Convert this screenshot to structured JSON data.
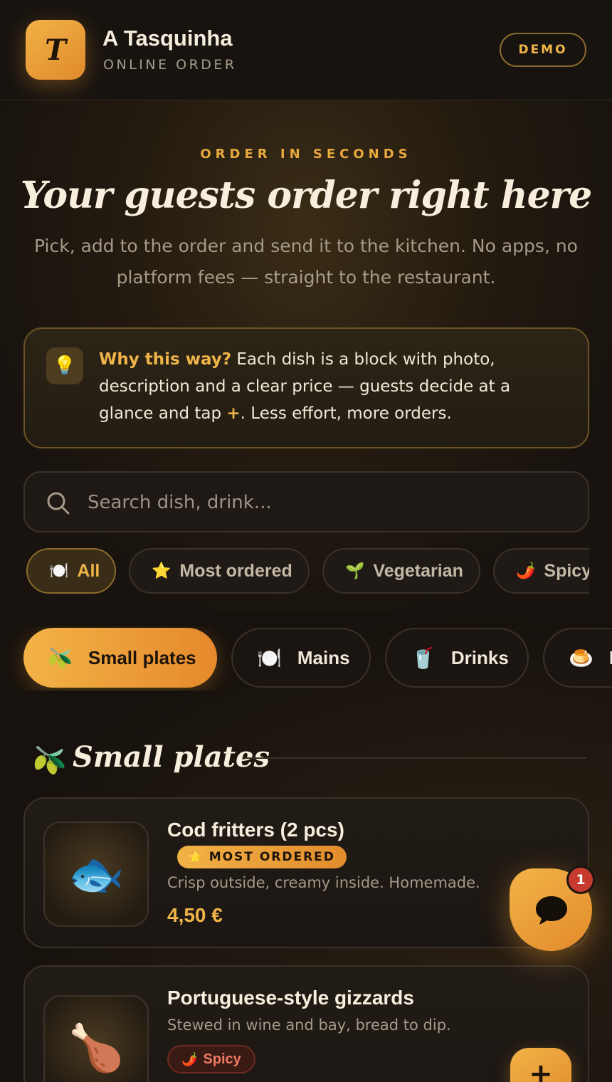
{
  "header": {
    "logo_letter": "T",
    "brand_name": "A Tasquinha",
    "brand_subtitle": "ONLINE ORDER",
    "demo_label": "DEMO"
  },
  "hero": {
    "eyebrow": "ORDER IN SECONDS",
    "title": "Your guests order right here",
    "subtitle": "Pick, add to the order and send it to the kitchen. No apps, no platform fees — straight to the restaurant."
  },
  "info": {
    "icon": "lightbulb-icon",
    "highlight": "Why this way?",
    "text_before_plus": " Each dish is a block with photo, description and a clear price — guests decide at a glance and tap ",
    "plus": "+",
    "text_after_plus": ". Less effort, more orders."
  },
  "search": {
    "placeholder": "Search dish, drink..."
  },
  "filters": [
    {
      "emoji": "🍽️",
      "label": "All",
      "active": true
    },
    {
      "emoji": "⭐",
      "label": "Most ordered",
      "active": false
    },
    {
      "emoji": "🌱",
      "label": "Vegetarian",
      "active": false
    },
    {
      "emoji": "🌶️",
      "label": "Spicy",
      "active": false
    }
  ],
  "tabs": [
    {
      "emoji": "🫒",
      "label": "Small plates",
      "active": true
    },
    {
      "emoji": "🍽️",
      "label": "Mains",
      "active": false
    },
    {
      "emoji": "🥤",
      "label": "Drinks",
      "active": false
    },
    {
      "emoji": "🍮",
      "label": "D",
      "active": false
    }
  ],
  "section": {
    "emoji": "🫒",
    "title": "Small plates"
  },
  "dishes": [
    {
      "emoji": "🐟",
      "name": "Cod fritters (2 pcs)",
      "badge_emoji": "⭐",
      "badge": "MOST ORDERED",
      "description": "Crisp outside, creamy inside. Homemade.",
      "price": "4,50 €"
    },
    {
      "emoji": "🍗",
      "name": "Portuguese-style gizzards",
      "description": "Stewed in wine and bay, bread to dip.",
      "tag_emoji": "🌶️",
      "tag": "Spicy",
      "add_label": "+"
    }
  ],
  "chat": {
    "icon": "chat-bubble-icon",
    "unread_count": "1"
  },
  "colors": {
    "accent": "#f0b548",
    "accent_gradient_start": "#f3b347",
    "accent_gradient_end": "#e5892c",
    "background": "#16120e",
    "spicy": "#f07a62",
    "badge_red": "#c73a2e"
  }
}
